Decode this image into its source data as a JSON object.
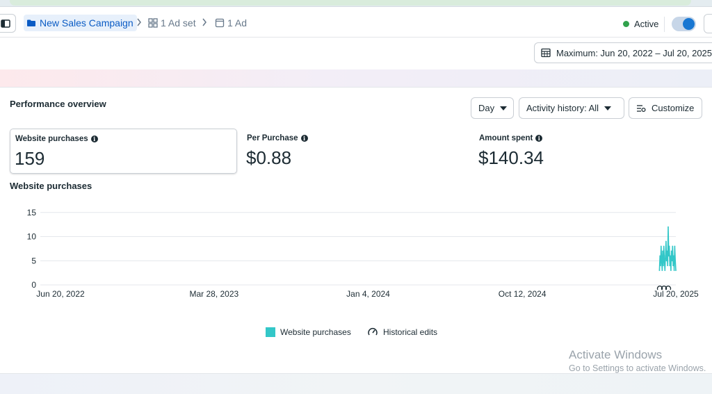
{
  "breadcrumb": {
    "campaign": "New Sales Campaign",
    "ad_set": "1 Ad set",
    "ad": "1 Ad"
  },
  "status": {
    "label": "Active",
    "color": "#31a24c"
  },
  "date_range": {
    "label": "Maximum: Jun 20, 2022 – Jul 20, 2025"
  },
  "performance": {
    "title": "Performance overview",
    "controls": {
      "day_label": "Day",
      "activity_label": "Activity history: All",
      "customize_label": "Customize"
    },
    "metrics": [
      {
        "label": "Website purchases",
        "value": "159",
        "selected": true
      },
      {
        "label": "Per Purchase",
        "value": "$0.88",
        "selected": false
      },
      {
        "label": "Amount spent",
        "value": "$140.34",
        "selected": false
      }
    ],
    "chart_title": "Website purchases",
    "legend": {
      "series_label": "Website purchases",
      "edits_label": "Historical edits"
    }
  },
  "chart_data": {
    "type": "line",
    "series_color": "#33c7c8",
    "y_ticks": [
      "0",
      "5",
      "10",
      "15",
      "20"
    ],
    "ylim": [
      0,
      20
    ],
    "xlim": [
      "2022-06-20",
      "2025-07-20"
    ],
    "x_ticks": [
      "Jun 20, 2022",
      "Mar 28, 2023",
      "Jan 4, 2024",
      "Oct 12, 2024",
      "Jul 20, 2025"
    ],
    "grid": true,
    "series": [
      {
        "name": "Website purchases",
        "x": [
          "2025-06-20",
          "2025-06-21",
          "2025-06-22",
          "2025-06-23",
          "2025-06-24",
          "2025-06-25",
          "2025-06-26",
          "2025-06-27",
          "2025-06-28",
          "2025-06-29",
          "2025-06-30",
          "2025-07-01",
          "2025-07-02",
          "2025-07-03",
          "2025-07-04",
          "2025-07-05",
          "2025-07-06",
          "2025-07-07",
          "2025-07-08",
          "2025-07-09",
          "2025-07-10",
          "2025-07-11",
          "2025-07-12",
          "2025-07-13",
          "2025-07-14",
          "2025-07-15",
          "2025-07-16",
          "2025-07-17",
          "2025-07-18",
          "2025-07-19",
          "2025-07-20"
        ],
        "values": [
          3,
          6,
          4,
          8,
          5,
          3,
          7,
          4,
          8,
          5,
          3,
          6,
          9,
          5,
          7,
          4,
          12,
          6,
          8,
          4,
          6,
          3,
          7,
          5,
          8,
          4,
          6,
          3,
          8,
          5,
          3
        ]
      }
    ],
    "edits_markers_count": 3
  },
  "watermark": {
    "line1": "Activate Windows",
    "line2": "Go to Settings to activate Windows."
  }
}
